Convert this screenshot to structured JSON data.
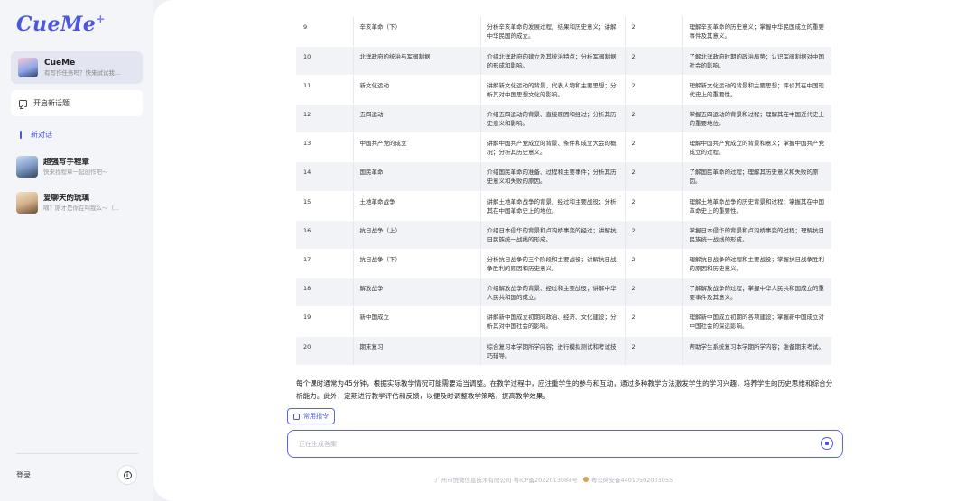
{
  "app": {
    "logo": "CueMe",
    "logo_mark": "+"
  },
  "sidebar": {
    "current_bot": {
      "name": "CueMe",
      "subtitle": "有写作任务吗？快来试试我..."
    },
    "new_topic_label": "开启新话题",
    "new_chat_label": "新对话",
    "chats": [
      {
        "name": "超强写手程章",
        "subtitle": "快来找程章一起创作吧～"
      },
      {
        "name": "爱聊天的琉璃",
        "subtitle": "嘀？刚才是你在叫我么～（..."
      }
    ],
    "login_label": "登录"
  },
  "table": {
    "rows": [
      {
        "no": "9",
        "title": "辛亥革命（下）",
        "desc": "分析辛亥革命的发展过程、结果和历史意义；讲解中华民国的成立。",
        "hours": "2",
        "goal": "理解辛亥革命的历史意义；掌握中华民国成立的重要事件及其意义。"
      },
      {
        "no": "10",
        "title": "北洋政府的统治与军阀割据",
        "desc": "介绍北洋政府的建立及其统治特点；分析军阀割据的形成和影响。",
        "hours": "2",
        "goal": "了解北洋政府时期的政治局势；认识军阀割据对中国社会的影响。"
      },
      {
        "no": "11",
        "title": "新文化运动",
        "desc": "讲解新文化运动的背景、代表人物和主要思想；分析其对中国思想文化的影响。",
        "hours": "2",
        "goal": "理解新文化运动的背景和主要思想；评价其在中国现代史上的重要性。"
      },
      {
        "no": "12",
        "title": "五四运动",
        "desc": "介绍五四运动的背景、直接原因和经过；分析其历史意义和影响。",
        "hours": "2",
        "goal": "掌握五四运动的背景和过程；理解其在中国近代史上的重要地位。"
      },
      {
        "no": "13",
        "title": "中国共产党的成立",
        "desc": "讲解中国共产党成立的背景、条件和成立大会的概况；分析其历史意义。",
        "hours": "2",
        "goal": "理解中国共产党成立的背景和意义；掌握中国共产党成立的过程。"
      },
      {
        "no": "14",
        "title": "国民革命",
        "desc": "介绍国民革命的准备、过程和主要事件；分析其历史意义和失败的原因。",
        "hours": "2",
        "goal": "了解国民革命的过程；理解其历史意义和失败的原因。"
      },
      {
        "no": "15",
        "title": "土地革命战争",
        "desc": "讲解土地革命战争的背景、经过和主要战役；分析其在中国革命史上的地位。",
        "hours": "2",
        "goal": "理解土地革命战争的历史背景和过程；掌握其在中国革命史上的重要性。"
      },
      {
        "no": "16",
        "title": "抗日战争（上）",
        "desc": "介绍日本侵华的背景和卢沟桥事变的经过；讲解抗日民族统一战线的形成。",
        "hours": "2",
        "goal": "掌握日本侵华的背景和卢沟桥事变的过程；理解抗日民族统一战线的形成。"
      },
      {
        "no": "17",
        "title": "抗日战争（下）",
        "desc": "分析抗日战争的三个阶段和主要战役；讲解抗日战争胜利的原因和历史意义。",
        "hours": "2",
        "goal": "理解抗日战争的过程和主要战役；掌握抗日战争胜利的原因和历史意义。"
      },
      {
        "no": "18",
        "title": "解放战争",
        "desc": "介绍解放战争的背景、经过和主要战役；讲解中华人民共和国的成立。",
        "hours": "2",
        "goal": "了解解放战争的过程；掌握中华人民共和国成立的重要事件及其意义。"
      },
      {
        "no": "19",
        "title": "新中国成立",
        "desc": "讲解新中国成立初期的政治、经济、文化建设；分析其对中国社会的影响。",
        "hours": "2",
        "goal": "理解新中国成立初期的各项建设；掌握新中国成立对中国社会的深远影响。"
      },
      {
        "no": "20",
        "title": "期末复习",
        "desc": "综合复习本学期所学内容；进行模拟测试和考试技巧辅导。",
        "hours": "2",
        "goal": "帮助学生系统复习本学期所学内容；准备期末考试。"
      }
    ]
  },
  "summary": "每个课时通常为45分钟，根据实际教学情况可能需要适当调整。在教学过程中，应注重学生的参与和互动，通过多种教学方法激发学生的学习兴趣，培养学生的历史思维和综合分析能力。此外，定期进行教学评估和反馈，以便及时调整教学策略，提高教学效果。",
  "composer": {
    "common_commands_label": "常用指令",
    "placeholder": "正在生成答案"
  },
  "footer": {
    "company": "广州市悦微信息技术有限公司",
    "icp": "粤ICP备2022013084号",
    "police": "粤公网安备44010502003055"
  },
  "colors": {
    "accent": "#4b57e0",
    "sidebar_bg": "#f4f5f9",
    "page_bg": "#eef0f5"
  }
}
